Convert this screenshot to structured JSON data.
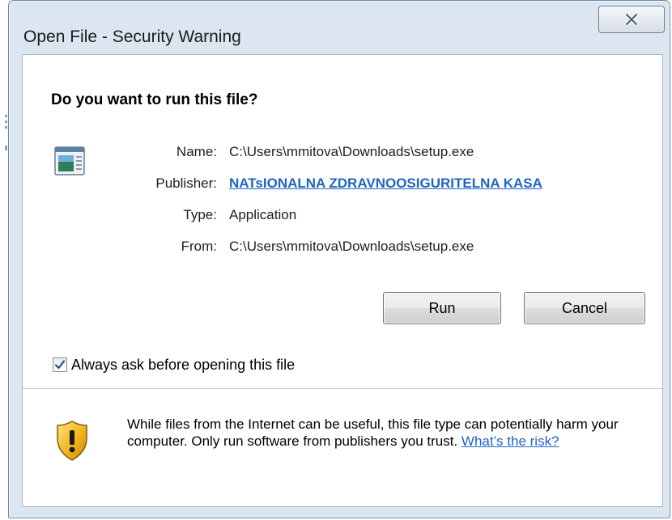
{
  "window": {
    "title": "Open File - Security Warning"
  },
  "dialog": {
    "question": "Do you want to run this file?",
    "properties": {
      "name_label": "Name:",
      "name_value": "C:\\Users\\mmitova\\Downloads\\setup.exe",
      "publisher_label": "Publisher:",
      "publisher_value": "NATsIONALNA ZDRAVNOOSIGURITELNA KASA",
      "type_label": "Type:",
      "type_value": "Application",
      "from_label": "From:",
      "from_value": "C:\\Users\\mmitova\\Downloads\\setup.exe"
    },
    "buttons": {
      "run_label": "Run",
      "cancel_label": "Cancel"
    },
    "checkbox": {
      "label": "Always ask before opening this file",
      "checked": true
    },
    "warning": {
      "text": "While files from the Internet can be useful, this file type can potentially harm your computer. Only run software from publishers you trust.",
      "link_text": "What’s the risk?"
    }
  },
  "icons": {
    "close": "close-icon",
    "file": "application-file-icon",
    "shield": "warning-shield-icon",
    "check": "checkmark-icon"
  },
  "colors": {
    "link": "#1f64c4",
    "frame": "#dbe6f1",
    "shield_yellow": "#f2b51f"
  }
}
